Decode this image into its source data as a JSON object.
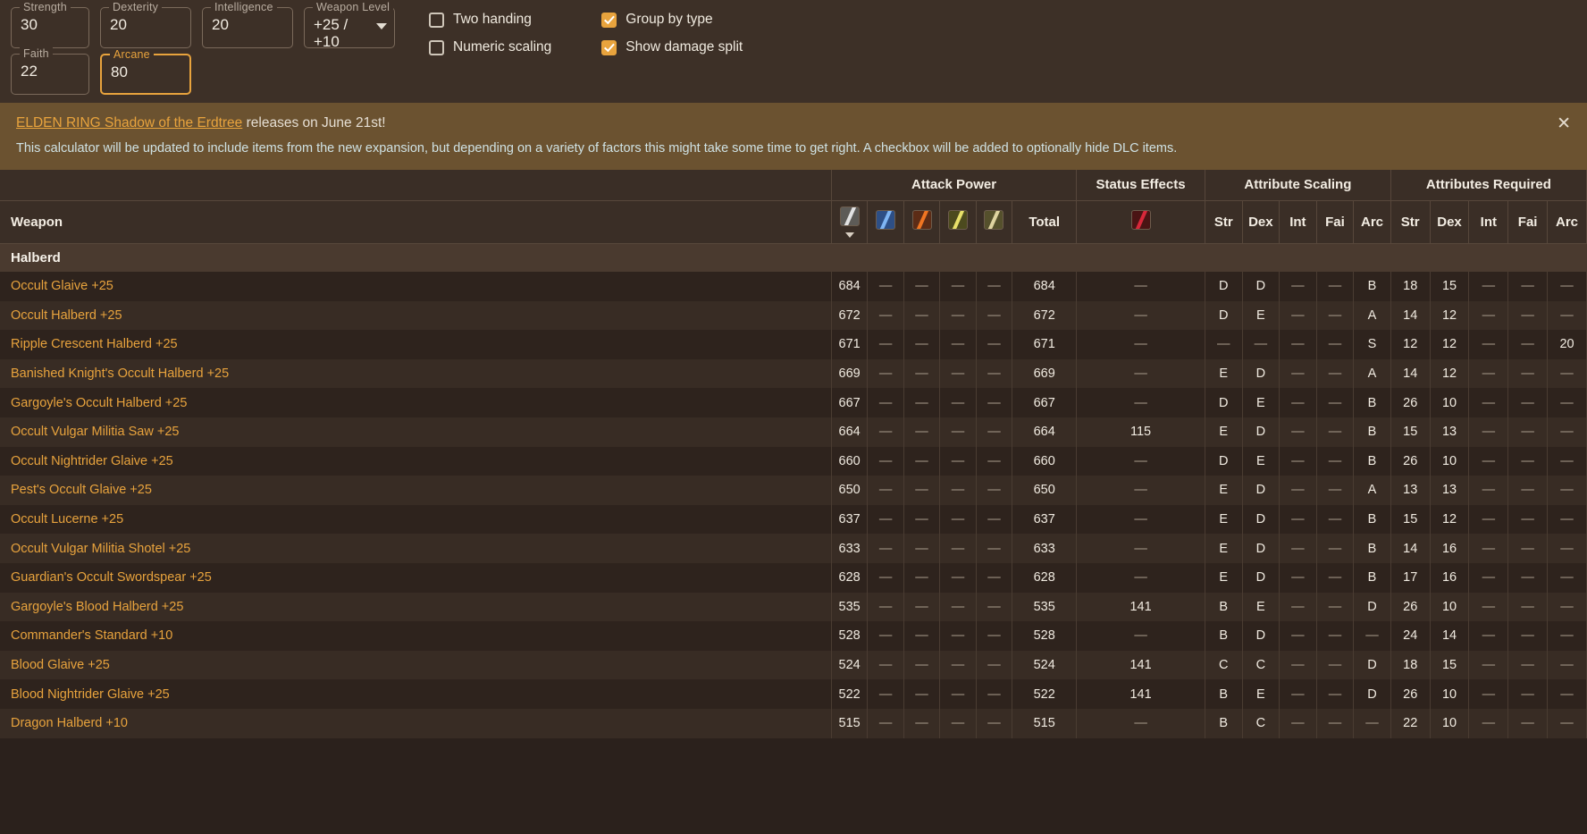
{
  "stats": {
    "fields": [
      {
        "label": "Strength",
        "value": "30",
        "focused": false
      },
      {
        "label": "Dexterity",
        "value": "20",
        "focused": false
      },
      {
        "label": "Intelligence",
        "value": "20",
        "focused": false
      },
      {
        "label": "Faith",
        "value": "22",
        "focused": false
      },
      {
        "label": "Arcane",
        "value": "80",
        "focused": true
      }
    ],
    "weapon_level": {
      "label": "Weapon Level",
      "value": "+25 / +10",
      "icon": "chevron-down-icon"
    }
  },
  "options": [
    {
      "label": "Two handing",
      "checked": false
    },
    {
      "label": "Group by type",
      "checked": true
    },
    {
      "label": "Numeric scaling",
      "checked": false
    },
    {
      "label": "Show damage split",
      "checked": true
    }
  ],
  "banner": {
    "link_text": "ELDEN RING Shadow of the Erdtree",
    "title_rest": " releases on June 21st!",
    "body": "This calculator will be updated to include items from the new expansion, but depending on a variety of factors this might take some time to get right. A checkbox will be added to optionally hide DLC items.",
    "close_icon": "close-icon",
    "background": "#6b5230",
    "accent": "#e8a33d"
  },
  "table": {
    "groups": [
      {
        "label": "Weapon",
        "span": 1
      },
      {
        "label": "Attack Power",
        "span": 6
      },
      {
        "label": "Status Effects",
        "span": 1
      },
      {
        "label": "Attribute Scaling",
        "span": 5
      },
      {
        "label": "Attributes Required",
        "span": 5
      }
    ],
    "weapon_column": "Weapon",
    "damage_icons": [
      "physical-damage-icon",
      "magic-damage-icon",
      "fire-damage-icon",
      "lightning-damage-icon",
      "holy-damage-icon"
    ],
    "total_label": "Total",
    "status_icon": "bleed-status-icon",
    "attr_headers": [
      "Str",
      "Dex",
      "Int",
      "Fai",
      "Arc"
    ],
    "sort_indicator": "sort-descending-icon",
    "group_header": "Halberd",
    "rows": [
      {
        "name": "Occult Glaive +25",
        "phys": "684",
        "magic": "—",
        "fire": "—",
        "light": "—",
        "holy": "—",
        "total": "684",
        "status": "—",
        "scaling": [
          "D",
          "D",
          "—",
          "—",
          "B"
        ],
        "required": [
          "18",
          "15",
          "—",
          "—",
          "—"
        ]
      },
      {
        "name": "Occult Halberd +25",
        "phys": "672",
        "magic": "—",
        "fire": "—",
        "light": "—",
        "holy": "—",
        "total": "672",
        "status": "—",
        "scaling": [
          "D",
          "E",
          "—",
          "—",
          "A"
        ],
        "required": [
          "14",
          "12",
          "—",
          "—",
          "—"
        ]
      },
      {
        "name": "Ripple Crescent Halberd +25",
        "phys": "671",
        "magic": "—",
        "fire": "—",
        "light": "—",
        "holy": "—",
        "total": "671",
        "status": "—",
        "scaling": [
          "—",
          "—",
          "—",
          "—",
          "S"
        ],
        "required": [
          "12",
          "12",
          "—",
          "—",
          "20"
        ]
      },
      {
        "name": "Banished Knight's Occult Halberd +25",
        "phys": "669",
        "magic": "—",
        "fire": "—",
        "light": "—",
        "holy": "—",
        "total": "669",
        "status": "—",
        "scaling": [
          "E",
          "D",
          "—",
          "—",
          "A"
        ],
        "required": [
          "14",
          "12",
          "—",
          "—",
          "—"
        ]
      },
      {
        "name": "Gargoyle's Occult Halberd +25",
        "phys": "667",
        "magic": "—",
        "fire": "—",
        "light": "—",
        "holy": "—",
        "total": "667",
        "status": "—",
        "scaling": [
          "D",
          "E",
          "—",
          "—",
          "B"
        ],
        "required": [
          "26",
          "10",
          "—",
          "—",
          "—"
        ]
      },
      {
        "name": "Occult Vulgar Militia Saw +25",
        "phys": "664",
        "magic": "—",
        "fire": "—",
        "light": "—",
        "holy": "—",
        "total": "664",
        "status": "115",
        "scaling": [
          "E",
          "D",
          "—",
          "—",
          "B"
        ],
        "required": [
          "15",
          "13",
          "—",
          "—",
          "—"
        ]
      },
      {
        "name": "Occult Nightrider Glaive +25",
        "phys": "660",
        "magic": "—",
        "fire": "—",
        "light": "—",
        "holy": "—",
        "total": "660",
        "status": "—",
        "scaling": [
          "D",
          "E",
          "—",
          "—",
          "B"
        ],
        "required": [
          "26",
          "10",
          "—",
          "—",
          "—"
        ]
      },
      {
        "name": "Pest's Occult Glaive +25",
        "phys": "650",
        "magic": "—",
        "fire": "—",
        "light": "—",
        "holy": "—",
        "total": "650",
        "status": "—",
        "scaling": [
          "E",
          "D",
          "—",
          "—",
          "A"
        ],
        "required": [
          "13",
          "13",
          "—",
          "—",
          "—"
        ]
      },
      {
        "name": "Occult Lucerne +25",
        "phys": "637",
        "magic": "—",
        "fire": "—",
        "light": "—",
        "holy": "—",
        "total": "637",
        "status": "—",
        "scaling": [
          "E",
          "D",
          "—",
          "—",
          "B"
        ],
        "required": [
          "15",
          "12",
          "—",
          "—",
          "—"
        ]
      },
      {
        "name": "Occult Vulgar Militia Shotel +25",
        "phys": "633",
        "magic": "—",
        "fire": "—",
        "light": "—",
        "holy": "—",
        "total": "633",
        "status": "—",
        "scaling": [
          "E",
          "D",
          "—",
          "—",
          "B"
        ],
        "required": [
          "14",
          "16",
          "—",
          "—",
          "—"
        ]
      },
      {
        "name": "Guardian's Occult Swordspear +25",
        "phys": "628",
        "magic": "—",
        "fire": "—",
        "light": "—",
        "holy": "—",
        "total": "628",
        "status": "—",
        "scaling": [
          "E",
          "D",
          "—",
          "—",
          "B"
        ],
        "required": [
          "17",
          "16",
          "—",
          "—",
          "—"
        ]
      },
      {
        "name": "Gargoyle's Blood Halberd +25",
        "phys": "535",
        "magic": "—",
        "fire": "—",
        "light": "—",
        "holy": "—",
        "total": "535",
        "status": "141",
        "scaling": [
          "B",
          "E",
          "—",
          "—",
          "D"
        ],
        "required": [
          "26",
          "10",
          "—",
          "—",
          "—"
        ]
      },
      {
        "name": "Commander's Standard +10",
        "phys": "528",
        "magic": "—",
        "fire": "—",
        "light": "—",
        "holy": "—",
        "total": "528",
        "status": "—",
        "scaling": [
          "B",
          "D",
          "—",
          "—",
          "—"
        ],
        "required": [
          "24",
          "14",
          "—",
          "—",
          "—"
        ]
      },
      {
        "name": "Blood Glaive +25",
        "phys": "524",
        "magic": "—",
        "fire": "—",
        "light": "—",
        "holy": "—",
        "total": "524",
        "status": "141",
        "scaling": [
          "C",
          "C",
          "—",
          "—",
          "D"
        ],
        "required": [
          "18",
          "15",
          "—",
          "—",
          "—"
        ]
      },
      {
        "name": "Blood Nightrider Glaive +25",
        "phys": "522",
        "magic": "—",
        "fire": "—",
        "light": "—",
        "holy": "—",
        "total": "522",
        "status": "141",
        "scaling": [
          "B",
          "E",
          "—",
          "—",
          "D"
        ],
        "required": [
          "26",
          "10",
          "—",
          "—",
          "—"
        ]
      },
      {
        "name": "Dragon Halberd +10",
        "phys": "515",
        "magic": "—",
        "fire": "—",
        "light": "—",
        "holy": "—",
        "total": "515",
        "status": "—",
        "scaling": [
          "B",
          "C",
          "—",
          "—",
          "—"
        ],
        "required": [
          "22",
          "10",
          "—",
          "—",
          "—"
        ]
      }
    ]
  }
}
